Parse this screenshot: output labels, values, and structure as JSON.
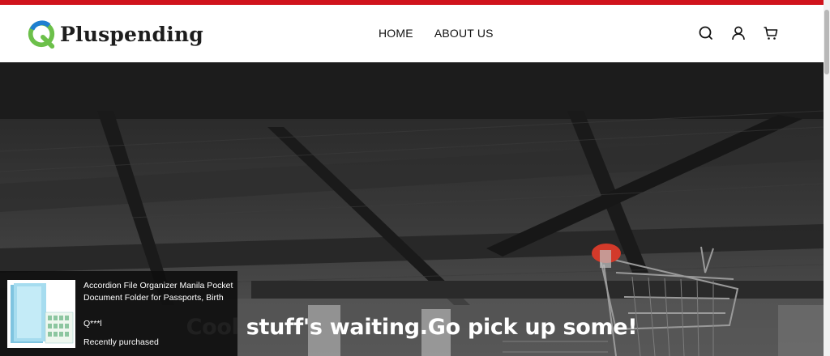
{
  "brand": {
    "name": "Pluspending",
    "accent_color": "#d0131c"
  },
  "nav": {
    "items": [
      {
        "label": "HOME"
      },
      {
        "label": "ABOUT US"
      }
    ]
  },
  "header_icons": [
    "search-icon",
    "account-icon",
    "cart-icon"
  ],
  "hero": {
    "headline": "Cool stuff's waiting.Go pick up some!"
  },
  "recent_purchase": {
    "product_name": "Accordion File Organizer Manila Pocket Document Folder for Passports, Birth",
    "buyer": "Q***l",
    "status": "Recently purchased"
  }
}
